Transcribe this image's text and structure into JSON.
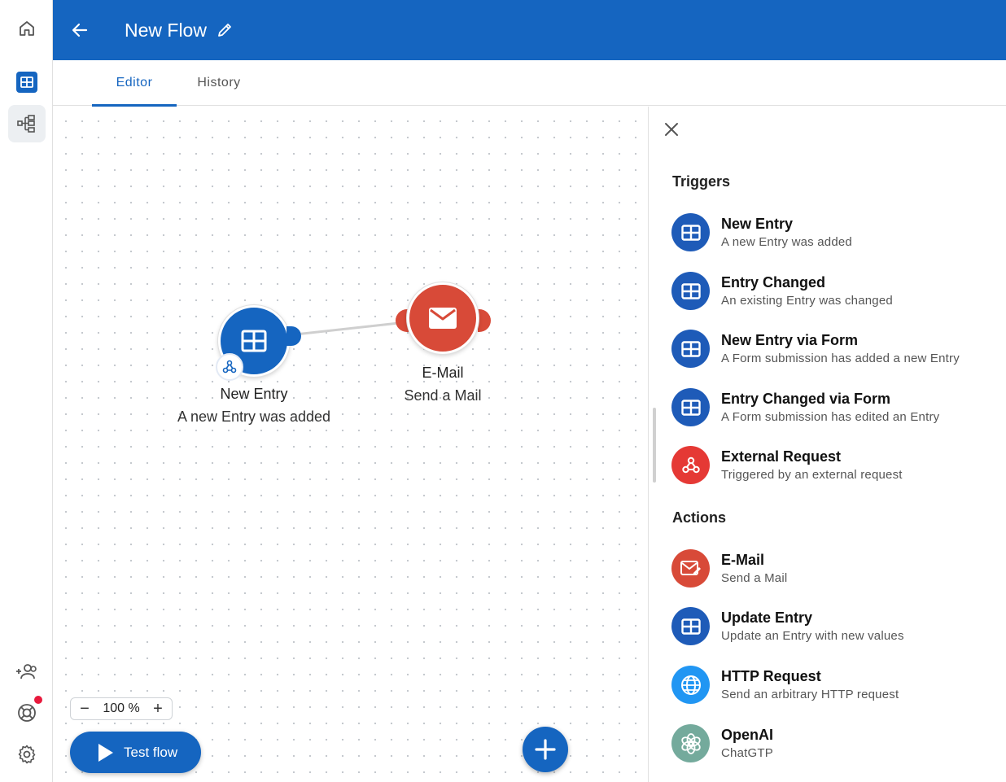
{
  "header": {
    "title": "New Flow"
  },
  "tabs": [
    {
      "label": "Editor",
      "active": true
    },
    {
      "label": "History",
      "active": false
    }
  ],
  "colors": {
    "primary": "#1565c0",
    "email_red": "#d84a38",
    "openai_teal": "#74aa9c",
    "http_blue": "#2196f3",
    "dot_red": "#e8193c"
  },
  "rail": {
    "icons": [
      "home-icon",
      "table-icon",
      "flow-tree-icon",
      "add-user-icon",
      "support-icon",
      "gear-icon"
    ]
  },
  "canvas": {
    "nodes": [
      {
        "title": "New Entry",
        "subtitle": "A new Entry was added",
        "icon": "table-icon"
      },
      {
        "title": "E-Mail",
        "subtitle": "Send a Mail",
        "icon": "mail-icon"
      }
    ],
    "zoom": {
      "value": "100 %"
    },
    "test_button": {
      "label": "Test flow"
    }
  },
  "panel": {
    "triggers_title": "Triggers",
    "triggers": [
      {
        "title": "New Entry",
        "subtitle": "A new Entry was added",
        "icon": "table-icon"
      },
      {
        "title": "Entry Changed",
        "subtitle": "An existing Entry was changed",
        "icon": "table-icon"
      },
      {
        "title": "New Entry via Form",
        "subtitle": "A Form submission has added a new Entry",
        "icon": "table-icon"
      },
      {
        "title": "Entry Changed via Form",
        "subtitle": "A Form submission has edited an Entry",
        "icon": "table-icon"
      },
      {
        "title": "External Request",
        "subtitle": "Triggered by an external request",
        "icon": "webhook-icon"
      }
    ],
    "actions_title": "Actions",
    "actions": [
      {
        "title": "E-Mail",
        "subtitle": "Send a Mail",
        "icon": "mail-edit-icon"
      },
      {
        "title": "Update Entry",
        "subtitle": "Update an Entry with new values",
        "icon": "table-icon"
      },
      {
        "title": "HTTP Request",
        "subtitle": "Send an arbitrary HTTP request",
        "icon": "globe-icon"
      },
      {
        "title": "OpenAI",
        "subtitle": "ChatGTP",
        "icon": "openai-icon"
      }
    ]
  }
}
